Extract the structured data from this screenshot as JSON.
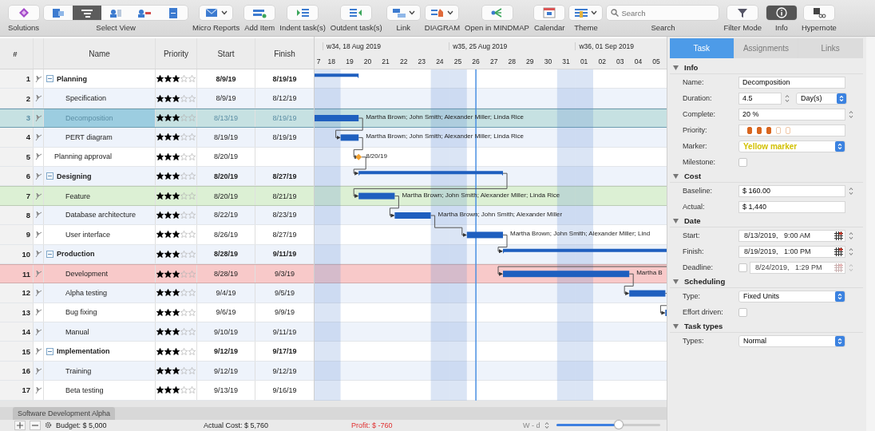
{
  "toolbar": [
    {
      "kind": "button",
      "label": "Solutions",
      "selected": false,
      "dropdown": false
    },
    {
      "kind": "segmented",
      "label": "Select View",
      "options": [
        {
          "selected": false
        },
        {
          "selected": true
        },
        {
          "selected": false
        },
        {
          "selected": false
        },
        {
          "selected": false
        }
      ]
    },
    {
      "kind": "button",
      "label": "Micro Reports",
      "selected": false,
      "dropdown": true
    },
    {
      "kind": "button",
      "label": "Add Item",
      "selected": false,
      "dropdown": false
    },
    {
      "kind": "button",
      "label": "Indent task(s)",
      "selected": false,
      "dropdown": false
    },
    {
      "kind": "button",
      "label": "Outdent task(s)",
      "selected": false,
      "dropdown": false
    },
    {
      "kind": "button",
      "label": "Link",
      "selected": false,
      "dropdown": true
    },
    {
      "kind": "button",
      "label": "DIAGRAM",
      "selected": false,
      "dropdown": true
    },
    {
      "kind": "button",
      "label": "Open in MINDMAP",
      "selected": false,
      "dropdown": false
    },
    {
      "kind": "button",
      "label": "Calendar",
      "selected": false,
      "dropdown": false
    },
    {
      "kind": "button",
      "label": "Theme",
      "selected": false,
      "dropdown": true
    },
    {
      "kind": "search",
      "label": "Search",
      "placeholder": "Search"
    },
    {
      "kind": "button",
      "label": "Filter Mode",
      "selected": false,
      "dropdown": false
    },
    {
      "kind": "button",
      "label": "Info",
      "selected": true,
      "dropdown": false
    },
    {
      "kind": "button",
      "label": "Hypernote",
      "selected": false,
      "dropdown": false
    }
  ],
  "columns": [
    "#",
    "Name",
    "Priority",
    "Start",
    "Finish"
  ],
  "tasks": [
    {
      "number": "1",
      "name": "Planning",
      "stars": 3,
      "start": "8/9/19",
      "finish": "8/19/19",
      "selected": false,
      "expanded": true,
      "children": [
        {
          "number": "2",
          "name": "Specification",
          "stars": 3,
          "start": "8/9/19",
          "finish": "8/12/19",
          "selected": false,
          "linked": false
        },
        {
          "number": "3",
          "name": "Decomposition",
          "stars": 3,
          "start": "8/13/19",
          "finish": "8/19/19",
          "selected": true,
          "linked": false,
          "bar_label": "Martha Brown; John Smith; Alexander Miller; Linda Rice"
        },
        {
          "number": "4",
          "name": "PERT diagram",
          "stars": 3,
          "start": "8/19/19",
          "finish": "8/19/19",
          "selected": false,
          "linked": true,
          "bar_label": "Martha Brown; John Smith; Alexander Miller; Linda Rice"
        }
      ]
    },
    {
      "number": "5",
      "name": "Planning approval",
      "stars": 3,
      "start": "8/20/19",
      "selected": false,
      "linked": true,
      "bar_label": "8/20/19"
    },
    {
      "number": "6",
      "name": "Designing",
      "stars": 3,
      "start": "8/20/19",
      "finish": "8/27/19",
      "selected": false,
      "expanded": true,
      "linked": true,
      "children": [
        {
          "number": "7",
          "name": "Feature",
          "stars": 3,
          "start": "8/20/19",
          "finish": "8/21/19",
          "selected": false,
          "color": "#dcf0d4",
          "linked": true,
          "bar_label": "Martha Brown; John Smith; Alexander Miller; Linda Rice"
        },
        {
          "number": "8",
          "name": "Database architecture",
          "stars": 3,
          "start": "8/22/19",
          "finish": "8/23/19",
          "selected": false,
          "linked": true,
          "bar_label": "Martha Brown; John Smith; Alexander Miller"
        },
        {
          "number": "9",
          "name": "User interface",
          "stars": 3,
          "start": "8/26/19",
          "finish": "8/27/19",
          "selected": false,
          "linked": true,
          "bar_label": "Martha Brown; John Smith; Alexander Miller; Lind"
        }
      ]
    },
    {
      "number": "10",
      "name": "Production",
      "stars": 3,
      "start": "8/28/19",
      "finish": "9/11/19",
      "selected": false,
      "expanded": true,
      "linked": true,
      "children": [
        {
          "number": "11",
          "name": "Development",
          "stars": 3,
          "start": "8/28/19",
          "finish": "9/3/19",
          "selected": false,
          "color": "#f8c9c9",
          "linked": true,
          "bar_label": "Martha B"
        },
        {
          "number": "12",
          "name": "Alpha testing",
          "stars": 3,
          "start": "9/4/19",
          "finish": "9/5/19",
          "selected": false,
          "linked": true
        },
        {
          "number": "13",
          "name": "Bug fixing",
          "stars": 3,
          "start": "9/6/19",
          "finish": "9/9/19",
          "selected": false,
          "linked": true
        },
        {
          "number": "14",
          "name": "Manual",
          "stars": 3,
          "start": "9/10/19",
          "finish": "9/11/19",
          "selected": false
        }
      ]
    },
    {
      "number": "15",
      "name": "Implementation",
      "stars": 3,
      "start": "9/12/19",
      "finish": "9/17/19",
      "selected": false,
      "expanded": true,
      "children": [
        {
          "number": "16",
          "name": "Training",
          "stars": 3,
          "start": "9/12/19",
          "finish": "9/12/19",
          "selected": false
        },
        {
          "number": "17",
          "name": "Beta testing",
          "stars": 3,
          "start": "9/13/19",
          "finish": "9/16/19",
          "selected": false
        }
      ]
    }
  ],
  "gantt": {
    "weeks": [
      "w34, 18 Aug 2019",
      "w35, 25 Aug 2019",
      "w36, 01 Sep 2019"
    ],
    "days": [
      {
        "label": "7",
        "weekend": true,
        "today": false
      },
      {
        "label": "18",
        "weekend": true,
        "today": false
      },
      {
        "label": "19",
        "weekend": false,
        "today": false
      },
      {
        "label": "20",
        "weekend": false,
        "today": false
      },
      {
        "label": "21",
        "weekend": false,
        "today": false
      },
      {
        "label": "22",
        "weekend": false,
        "today": false
      },
      {
        "label": "23",
        "weekend": false,
        "today": false
      },
      {
        "label": "24",
        "weekend": true,
        "today": false
      },
      {
        "label": "25",
        "weekend": true,
        "today": false
      },
      {
        "label": "26",
        "weekend": false,
        "today": true
      },
      {
        "label": "27",
        "weekend": false,
        "today": false
      },
      {
        "label": "28",
        "weekend": false,
        "today": false
      },
      {
        "label": "29",
        "weekend": false,
        "today": false
      },
      {
        "label": "30",
        "weekend": false,
        "today": false
      },
      {
        "label": "31",
        "weekend": true,
        "today": false
      },
      {
        "label": "01",
        "weekend": true,
        "today": false
      },
      {
        "label": "02",
        "weekend": false,
        "today": false
      },
      {
        "label": "03",
        "weekend": false,
        "today": false
      },
      {
        "label": "04",
        "weekend": false,
        "today": false
      },
      {
        "label": "05",
        "weekend": false,
        "today": false
      }
    ]
  },
  "inspector": {
    "tabs": [
      {
        "label": "Task",
        "selected": true
      },
      {
        "label": "Assignments",
        "selected": false
      },
      {
        "label": "Links",
        "selected": false
      }
    ],
    "sections": [
      {
        "title": "Info",
        "expanded": true,
        "fields": [
          {
            "kind": "text",
            "label": "Name:",
            "value": "Decomposition"
          },
          {
            "kind": "stepper_select",
            "label": "Duration:",
            "value": "4.5",
            "option": "Day(s)"
          },
          {
            "kind": "stepper",
            "label": "Complete:",
            "value": "20 %"
          },
          {
            "kind": "stars",
            "label": "Priority:",
            "stars": 3
          },
          {
            "kind": "select",
            "label": "Marker:",
            "value": "Yellow marker",
            "color": "#d2c000"
          },
          {
            "kind": "checkbox",
            "label": "Milestone:",
            "checked": false
          }
        ]
      },
      {
        "title": "Cost",
        "expanded": true,
        "fields": [
          {
            "kind": "stepper",
            "label": "Baseline:",
            "value": "$ 160.00"
          },
          {
            "kind": "text",
            "label": "Actual:",
            "value": "$ 1,440"
          }
        ]
      },
      {
        "title": "Date",
        "expanded": true,
        "fields": [
          {
            "kind": "datetime",
            "label": "Start:",
            "value": "8/13/2019,   9:00 AM",
            "disabled": false
          },
          {
            "kind": "datetime",
            "label": "Finish:",
            "value": "8/19/2019,   1:00 PM",
            "disabled": false
          },
          {
            "kind": "datetime",
            "label": "Deadline:",
            "value": "8/24/2019,   1:29 PM",
            "disabled": true,
            "checked": false
          }
        ]
      },
      {
        "title": "Scheduling",
        "expanded": true,
        "fields": [
          {
            "kind": "select",
            "label": "Type:",
            "value": "Fixed Units"
          },
          {
            "kind": "checkbox",
            "label": "Effort driven:",
            "checked": false
          }
        ]
      },
      {
        "title": "Task types",
        "expanded": true,
        "fields": [
          {
            "kind": "select",
            "label": "Types:",
            "value": "Normal"
          }
        ]
      }
    ]
  },
  "sheet_tabs": [
    {
      "label": "Software Development Alpha",
      "selected": true
    }
  ],
  "status_bar": {
    "budget": "Budget: $ 5,000",
    "actual_cost": "Actual Cost: $ 5,760",
    "profit": "Profit: $ -760",
    "scale": "W - d",
    "zoom": {
      "level": 0.6
    }
  }
}
